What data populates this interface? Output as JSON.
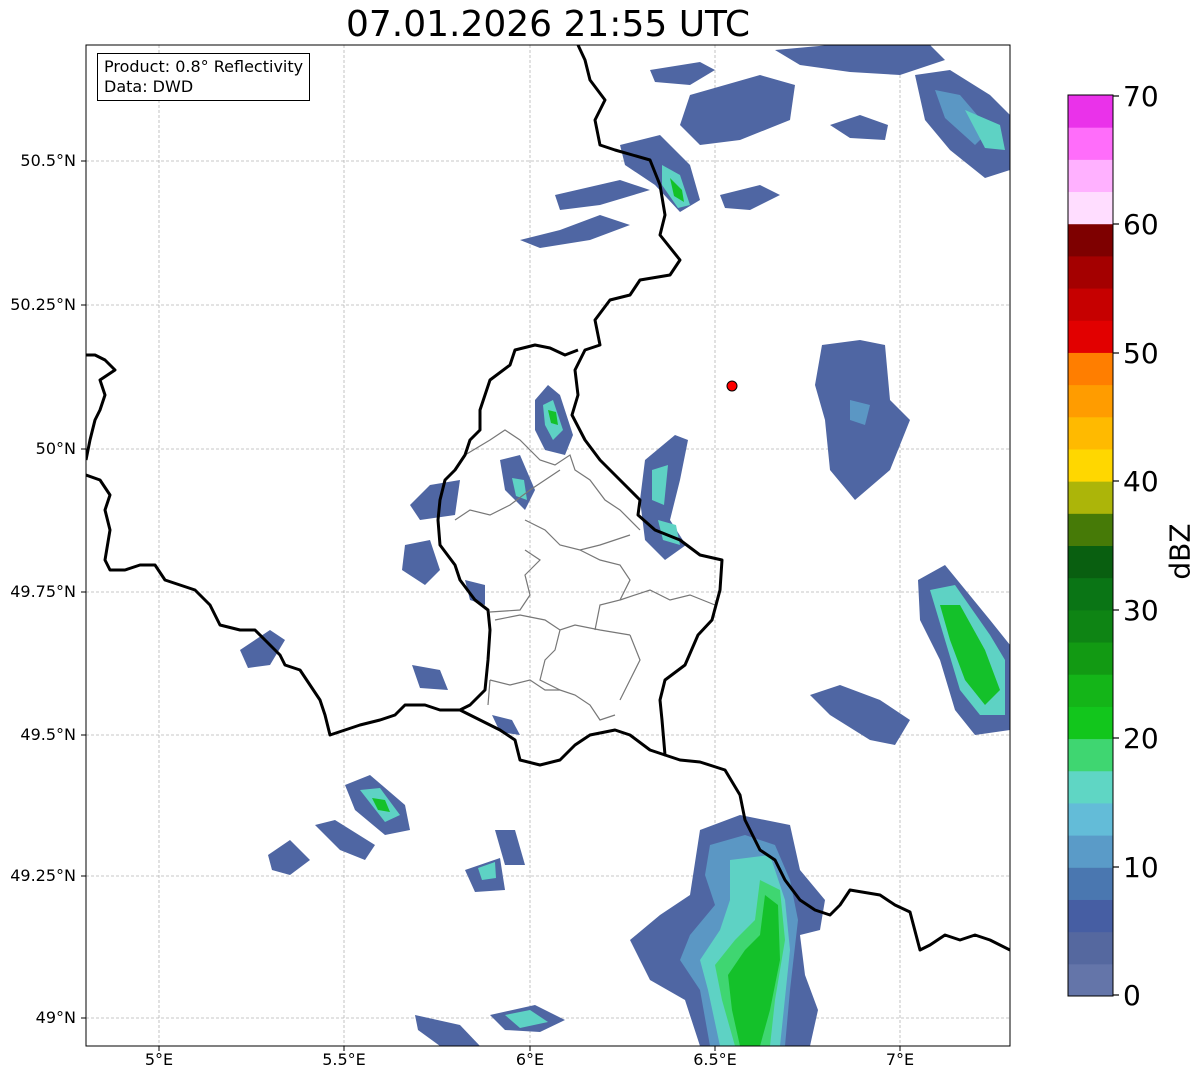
{
  "title": "07.01.2026 21:55 UTC",
  "info": {
    "product": "Product: 0.8° Reflectivity",
    "data": "Data: DWD"
  },
  "lat_labels": [
    "50.5°N",
    "50.25°N",
    "50°N",
    "49.75°N",
    "49.5°N",
    "49.25°N",
    "49°N"
  ],
  "lon_labels": [
    "5°E",
    "5.5°E",
    "6°E",
    "6.5°E",
    "7°E"
  ],
  "colorbar": {
    "label": "dBZ",
    "ticks": [
      "0",
      "10",
      "20",
      "30",
      "40",
      "50",
      "60",
      "70"
    ],
    "colors": [
      "#6475a9",
      "#55689f",
      "#465ea3",
      "#4a77b0",
      "#5a9bc8",
      "#63bcd8",
      "#5fd6c4",
      "#3fd671",
      "#12c61c",
      "#14b518",
      "#129a13",
      "#0e8414",
      "#0a7515",
      "#095f10",
      "#467a07",
      "#acb509",
      "#ffd700",
      "#ffba00",
      "#ff9c00",
      "#ff7e00",
      "#e20000",
      "#c60000",
      "#a40000",
      "#7e0000",
      "#ffddff",
      "#ffb1ff",
      "#ff6dfa",
      "#ea32ea"
    ]
  },
  "radar_site": {
    "color": "#ff0000"
  },
  "echo_colors": {
    "weak": "#4f66a3",
    "light": "#5b97c4",
    "mid": "#5ed2c4",
    "strong": "#14c12a"
  }
}
